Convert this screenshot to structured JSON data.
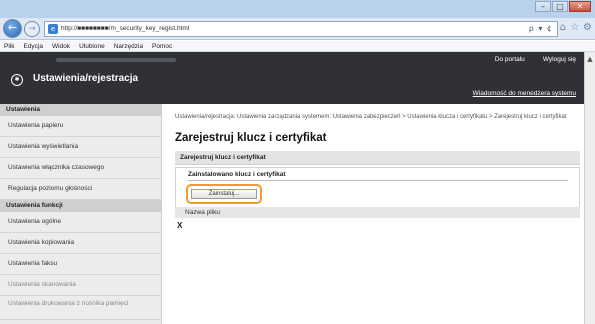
{
  "browser": {
    "window_controls": [
      "–",
      "□",
      "✕"
    ],
    "address": "http://■■■■■■■■/m_security_key_regist.html",
    "address_controls": "ρ ▾ ¢",
    "toolbar_icons": [
      "⌂",
      "☆",
      "⚙"
    ]
  },
  "menu": [
    "Plik",
    "Edycja",
    "Widok",
    "Ulubione",
    "Narzędzia",
    "Pomoc"
  ],
  "header": {
    "title": "Ustawienia/rejestracja",
    "portal_link": "Do portalu",
    "logout_link": "Wyloguj się",
    "manager_link": "Wiadomość do menedżera systemu"
  },
  "sidebar": {
    "section1": "Ustawienia",
    "items1": [
      "Ustawienia papieru",
      "Ustawienia wyświetlania",
      "Ustawienia włącznika czasowego",
      "Regulacja poziomu głośności"
    ],
    "section2": "Ustawienia funkcji",
    "items2": [
      "Ustawienia ogólne",
      "Ustawienia kopiowania",
      "Ustawienia faksu",
      "Ustawienia skanowania",
      "Ustawienia drukowania z nośnika pamięci"
    ]
  },
  "main": {
    "breadcrumb": "Ustawienia/rejestracja: Ustawienia zarządzania systemem: Ustawienia zabezpieczeń > Ustawienia klucza i certyfikatu > Zarejestruj klucz i certyfikat",
    "title": "Zarejestruj klucz i certyfikat",
    "section_bar": "Zarejestruj klucz i certyfikat",
    "panel_label": "Zainstalowano klucz i certyfikat",
    "install_button": "Zainstaluj...",
    "file_name_header": "Nazwa pliku",
    "x_mark": "X"
  }
}
